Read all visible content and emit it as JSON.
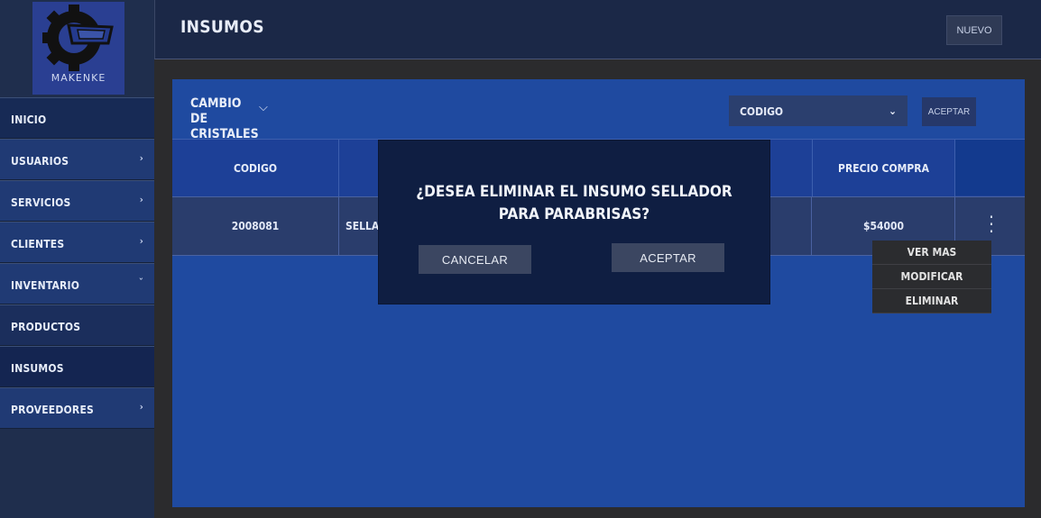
{
  "brand": {
    "name": "MAKENKE"
  },
  "sidebar": {
    "items": [
      {
        "label": "INICIO",
        "has_chevron": false
      },
      {
        "label": "USUARIOS",
        "has_chevron": true
      },
      {
        "label": "SERVICIOS",
        "has_chevron": true
      },
      {
        "label": "CLIENTES",
        "has_chevron": true
      },
      {
        "label": "INVENTARIO",
        "has_chevron": true
      },
      {
        "label": "PRODUCTOS",
        "has_chevron": false
      },
      {
        "label": "INSUMOS",
        "has_chevron": false
      },
      {
        "label": "PROVEEDORES",
        "has_chevron": true
      }
    ]
  },
  "header": {
    "title": "INSUMOS",
    "new_button": "NUEVO"
  },
  "filter": {
    "category": "CAMBIO DE CRISTALES",
    "select_value": "CODIGO",
    "accept_button": "ACEPTAR"
  },
  "table": {
    "headers": [
      "CODIGO",
      "PRECIO COMPRA"
    ],
    "rows": [
      {
        "codigo": "2008081",
        "nombre_partial": "SELLAD",
        "precio": "$54000"
      }
    ]
  },
  "context_menu": {
    "items": [
      "VER MAS",
      "MODIFICAR",
      "ELIMINAR"
    ]
  },
  "modal": {
    "message": "¿DESEA ELIMINAR EL INSUMO SELLADOR PARA PARABRISAS?",
    "cancel": "CANCELAR",
    "accept": "ACEPTAR"
  }
}
